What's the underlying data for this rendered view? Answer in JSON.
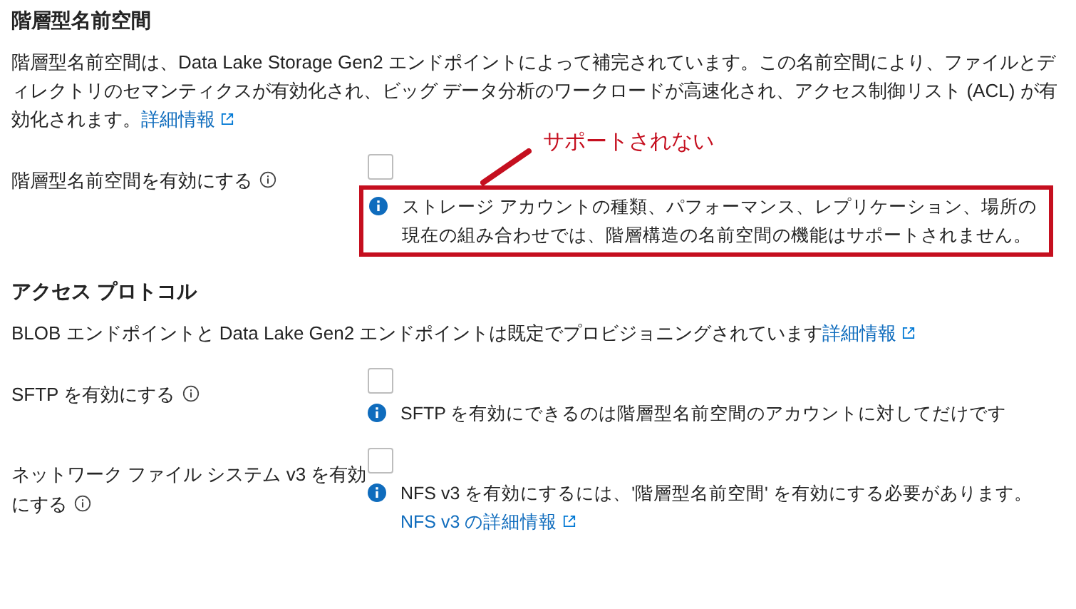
{
  "sections": [
    {
      "heading": "階層型名前空間",
      "description": {
        "text": "階層型名前空間は、Data Lake Storage Gen2 エンドポイントによって補完されています。この名前空間により、ファイルとディレクトリのセマンティクスが有効化され、ビッグ データ分析のワークロードが高速化され、アクセス制御リスト (ACL) が有効化されます。",
        "link": "詳細情報"
      },
      "settings": [
        {
          "label": "階層型名前空間を有効にする",
          "checked": false,
          "message": {
            "text": "ストレージ アカウントの種類、パフォーマンス、レプリケーション、場所の現在の組み合わせでは、階層構造の名前空間の機能はサポートされません。"
          },
          "annotation": "サポートされない"
        }
      ]
    },
    {
      "heading": "アクセス プロトコル",
      "description": {
        "text": "BLOB エンドポイントと Data Lake Gen2 エンドポイントは既定でプロビジョニングされています",
        "link": "詳細情報"
      },
      "settings": [
        {
          "label": "SFTP を有効にする",
          "checked": false,
          "message": {
            "text": "SFTP を有効にできるのは階層型名前空間のアカウントに対してだけです"
          }
        },
        {
          "label": "ネットワーク ファイル システム v3 を有効にする",
          "checked": false,
          "message": {
            "text": "NFS v3 を有効にするには、'階層型名前空間' を有効にする必要があります。",
            "link": "NFS v3 の詳細情報"
          }
        }
      ]
    }
  ]
}
